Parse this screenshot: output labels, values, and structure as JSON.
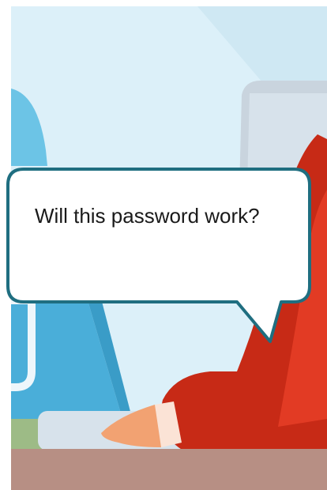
{
  "speech": {
    "text": "Will this password work?"
  },
  "colors": {
    "sky": "#d9eef8",
    "floor": "#b78f84",
    "bubble_border": "#1f6e80",
    "character_red": "#c72a16",
    "skin": "#f2a272",
    "chair_blue": "#5ab3e0",
    "desk_gray": "#d7e2eb"
  }
}
